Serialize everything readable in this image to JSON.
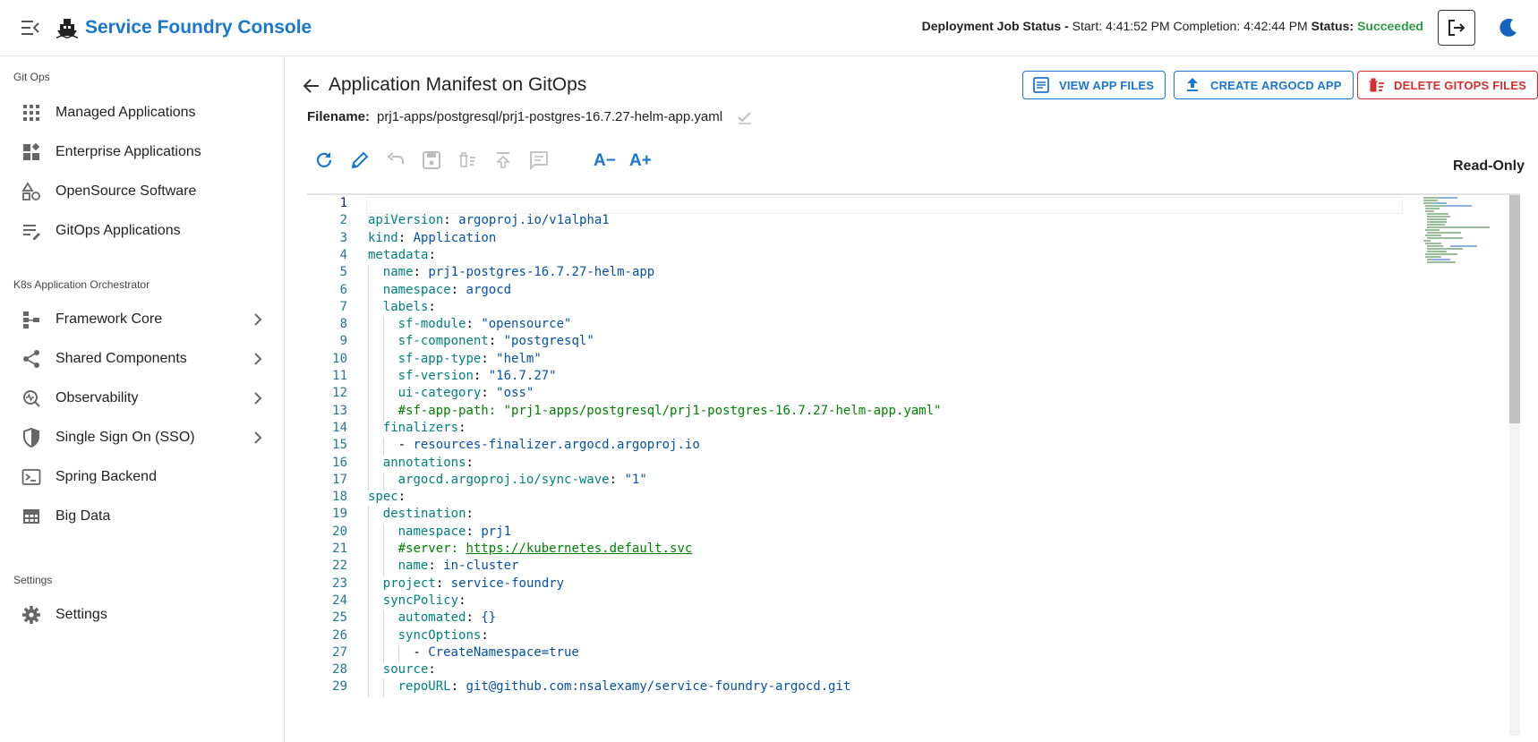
{
  "header": {
    "app_title": "Service Foundry Console",
    "job_status_label": "Deployment Job Status -",
    "start_text": "Start: 4:41:52 PM",
    "completion_text": "Completion: 4:42:44 PM",
    "status_label": "Status:",
    "status_value": "Succeeded",
    "status_color": "#2e9a43",
    "brand_color": "#1976d2"
  },
  "sidebar": {
    "sections": [
      {
        "title": "Git Ops"
      },
      {
        "title": "K8s Application Orchestrator"
      },
      {
        "title": "Settings"
      }
    ],
    "items": [
      {
        "label": "Managed Applications",
        "icon": "apps-grid-icon"
      },
      {
        "label": "Enterprise Applications",
        "icon": "widgets-icon"
      },
      {
        "label": "OpenSource Software",
        "icon": "shapes-icon"
      },
      {
        "label": "GitOps Applications",
        "icon": "list-edit-icon"
      },
      {
        "label": "Framework Core",
        "icon": "schema-icon",
        "expandable": true
      },
      {
        "label": "Shared Components",
        "icon": "share-icon",
        "expandable": true
      },
      {
        "label": "Observability",
        "icon": "monitor-icon",
        "expandable": true
      },
      {
        "label": "Single Sign On (SSO)",
        "icon": "shield-icon",
        "expandable": true
      },
      {
        "label": "Spring Backend",
        "icon": "terminal-icon"
      },
      {
        "label": "Big Data",
        "icon": "table-icon"
      },
      {
        "label": "Settings",
        "icon": "gear-icon"
      }
    ]
  },
  "main": {
    "title": "Application Manifest on GitOps",
    "buttons": {
      "view_files": "VIEW APP FILES",
      "create_argocd": "CREATE ARGOCD APP",
      "delete_gitops": "DELETE GITOPS FILES"
    },
    "filename_label": "Filename:",
    "filename_value": "prj1-apps/postgresql/prj1-postgres-16.7.27-helm-app.yaml",
    "toolbar": {
      "font_decrease": "A−",
      "font_increase": "A+",
      "mode": "Read-Only"
    }
  },
  "editor": {
    "line_numbers": [
      "1",
      "2",
      "3",
      "4",
      "5",
      "6",
      "7",
      "8",
      "9",
      "10",
      "11",
      "12",
      "13",
      "14",
      "15",
      "16",
      "17",
      "18",
      "19",
      "20",
      "21",
      "22",
      "23",
      "24",
      "25",
      "26",
      "27",
      "28",
      "29"
    ],
    "lines": [
      {
        "k": "",
        "s": "",
        "v": ""
      },
      {
        "k": "apiVersion",
        "s": ": ",
        "v": "argoproj.io/v1alpha1"
      },
      {
        "k": "kind",
        "s": ": ",
        "v": "Application"
      },
      {
        "k": "metadata",
        "s": ":",
        "v": ""
      },
      {
        "k": "name",
        "s": ": ",
        "v": "prj1-postgres-16.7.27-helm-app"
      },
      {
        "k": "namespace",
        "s": ": ",
        "v": "argocd"
      },
      {
        "k": "labels",
        "s": ":",
        "v": ""
      },
      {
        "k": "sf-module",
        "s": ": ",
        "v": "\"opensource\""
      },
      {
        "k": "sf-component",
        "s": ": ",
        "v": "\"postgresql\""
      },
      {
        "k": "sf-app-type",
        "s": ": ",
        "v": "\"helm\""
      },
      {
        "k": "sf-version",
        "s": ": ",
        "v": "\"16.7.27\""
      },
      {
        "k": "ui-category",
        "s": ": ",
        "v": "\"oss\""
      },
      {
        "k": "#sf-app-path: \"prj1-apps/postgresql/prj1-postgres-16.7.27-helm-app.yaml\"",
        "s": "",
        "v": ""
      },
      {
        "k": "finalizers",
        "s": ":",
        "v": ""
      },
      {
        "k": "- ",
        "s": "",
        "v": "resources-finalizer.argocd.argoproj.io"
      },
      {
        "k": "annotations",
        "s": ":",
        "v": ""
      },
      {
        "k": "argocd.argoproj.io/sync-wave",
        "s": ": ",
        "v": "\"1\""
      },
      {
        "k": "spec",
        "s": ":",
        "v": ""
      },
      {
        "k": "destination",
        "s": ":",
        "v": ""
      },
      {
        "k": "namespace",
        "s": ": ",
        "v": "prj1"
      },
      {
        "k": "#server: ",
        "s": "",
        "v": "https://kubernetes.default.svc"
      },
      {
        "k": "name",
        "s": ": ",
        "v": "in-cluster"
      },
      {
        "k": "project",
        "s": ": ",
        "v": "service-foundry"
      },
      {
        "k": "syncPolicy",
        "s": ":",
        "v": ""
      },
      {
        "k": "automated",
        "s": ": ",
        "v": "{}"
      },
      {
        "k": "syncOptions",
        "s": ":",
        "v": ""
      },
      {
        "k": "- ",
        "s": "",
        "v": "CreateNamespace=true"
      },
      {
        "k": "source",
        "s": ":",
        "v": ""
      },
      {
        "k": "repoURL",
        "s": ": ",
        "v": "git@github.com:nsalexamy/service-foundry-argocd.git"
      }
    ]
  }
}
